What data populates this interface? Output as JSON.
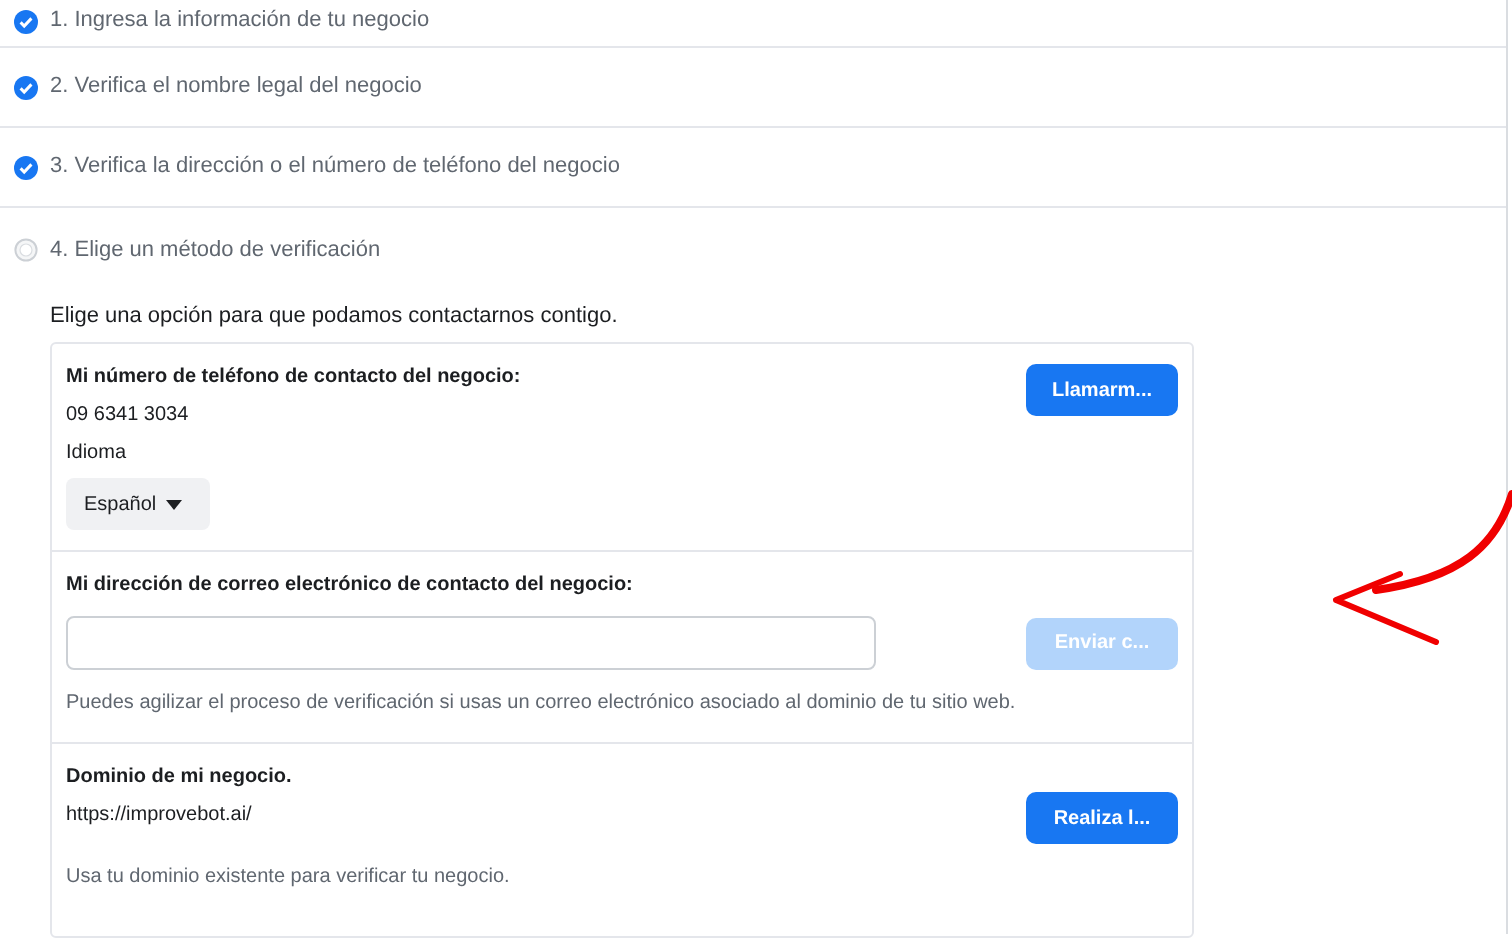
{
  "steps": [
    {
      "label": "1. Ingresa la información de tu negocio",
      "completed": true
    },
    {
      "label": "2. Verifica el nombre legal del negocio",
      "completed": true
    },
    {
      "label": "3. Verifica la dirección o el número de teléfono del negocio",
      "completed": true
    },
    {
      "label": "4. Elige un método de verificación",
      "completed": false
    }
  ],
  "intro": "Elige una opción para que podamos contactarnos contigo.",
  "options": [
    {
      "kind": "phone",
      "title": "Mi número de teléfono de contacto del negocio:",
      "value": "09 6341 3034",
      "language_label": "Idioma",
      "language": "Español",
      "button": {
        "label": "Llamarm...",
        "disabled": false
      }
    },
    {
      "kind": "email",
      "title": "Mi dirección de correo electrónico de contacto del negocio:",
      "hint": "Puedes agilizar el proceso de verificación si usas un correo electrónico asociado al dominio de tu sitio web.",
      "button": {
        "label": "Enviar c...",
        "disabled": true
      }
    },
    {
      "kind": "domain",
      "title": "Dominio de mi negocio.",
      "value": "https://improvebot.ai/",
      "hint": "Usa tu dominio existente para verificar tu negocio.",
      "button": {
        "label": "Realiza l...",
        "disabled": false
      }
    }
  ],
  "annotation": {
    "kind": "arrow"
  }
}
